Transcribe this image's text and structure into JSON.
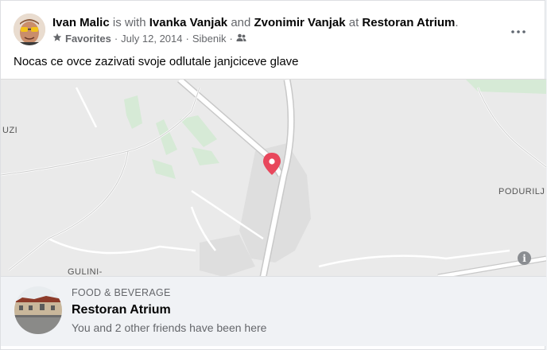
{
  "post": {
    "author": "Ivan Malic",
    "with_text": "is with",
    "friend1": "Ivanka Vanjak",
    "and_text": "and",
    "friend2": "Zvonimir Vanjak",
    "at_text": "at",
    "place": "Restoran Atrium",
    "period": ".",
    "favorites": "Favorites",
    "dot": "·",
    "date": "July 12, 2014",
    "city": "Sibenik",
    "text": "Nocas ce ovce zazivati svoje odlutale janjciceve glave"
  },
  "map": {
    "label_uzi": "UZI",
    "label_podurilj": "PODURILJ",
    "label_gulini": "GULINI-",
    "info": "i",
    "pin_color": "#e8475c"
  },
  "place_card": {
    "category": "FOOD & BEVERAGE",
    "name": "Restoran Atrium",
    "subtitle": "You and 2 other friends have been here"
  },
  "icons": {
    "favorites": "star-icon",
    "audience": "friends-icon",
    "more": "more-options-icon",
    "pin": "map-pin-icon",
    "info": "info-icon"
  }
}
